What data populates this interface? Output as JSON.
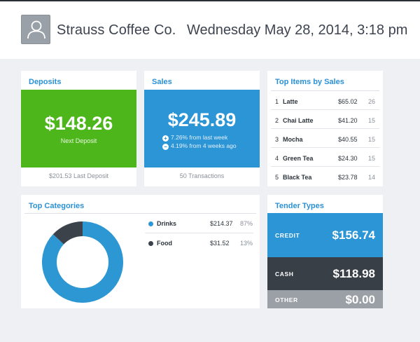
{
  "header": {
    "merchant_name": "Strauss Coffee Co.",
    "datetime": "Wednesday May 28, 2014, 3:18 pm"
  },
  "deposits": {
    "title": "Deposits",
    "amount": "$148.26",
    "subtitle": "Next Deposit",
    "footer": "$201.53 Last Deposit"
  },
  "sales": {
    "title": "Sales",
    "amount": "$245.89",
    "change_week": "7.26% from last week",
    "change_4weeks": "4.19% from 4 weeks ago",
    "footer": "50 Transactions"
  },
  "top_items": {
    "title": "Top Items by Sales",
    "rows": [
      {
        "rank": "1",
        "name": "Latte",
        "amount": "$65.02",
        "count": "26"
      },
      {
        "rank": "2",
        "name": "Chai Latte",
        "amount": "$41.20",
        "count": "15"
      },
      {
        "rank": "3",
        "name": "Mocha",
        "amount": "$40.55",
        "count": "15"
      },
      {
        "rank": "4",
        "name": "Green Tea",
        "amount": "$24.30",
        "count": "15"
      },
      {
        "rank": "5",
        "name": "Black Tea",
        "amount": "$23.78",
        "count": "14"
      }
    ]
  },
  "categories": {
    "title": "Top Categories",
    "rows": [
      {
        "name": "Drinks",
        "amount": "$214.37",
        "percent": "87%"
      },
      {
        "name": "Food",
        "amount": "$31.52",
        "percent": "13%"
      }
    ]
  },
  "tender": {
    "title": "Tender Types",
    "rows": [
      {
        "label": "CREDIT",
        "amount": "$156.74"
      },
      {
        "label": "CASH",
        "amount": "$118.98"
      },
      {
        "label": "OTHER",
        "amount": "$0.00"
      }
    ]
  },
  "chart_data": {
    "type": "pie",
    "categories": [
      "Drinks",
      "Food"
    ],
    "values": [
      87,
      13
    ],
    "colors": [
      "#2d97d4",
      "#3b424a"
    ]
  },
  "colors": {
    "accent_blue": "#2b91d6",
    "deposit_green": "#4cb61a",
    "sales_blue": "#2b95d6",
    "credit_blue": "#2b95d6",
    "cash_dark": "#383f47",
    "other_gray": "#9aa0a6"
  },
  "icons": {
    "avatar": "user-silhouette-icon",
    "up": "plus-circle-icon",
    "down": "minus-circle-icon"
  }
}
